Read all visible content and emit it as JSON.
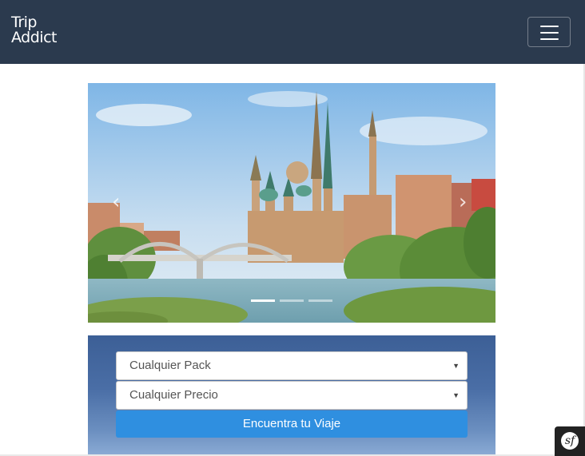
{
  "brand": {
    "line1": "Trip",
    "line2": "Addict"
  },
  "navbar": {
    "toggler_icon": "hamburger-icon"
  },
  "carousel": {
    "prev_icon": "‹",
    "next_icon": "›",
    "indicators": 3,
    "active_slide": 1
  },
  "search": {
    "pack_select": "Cualquier Pack",
    "price_select": "Cualquier Precio",
    "submit_label": "Encuentra tu Viaje"
  },
  "toolbar": {
    "symfony_label": "sf"
  },
  "colors": {
    "navbar": "#2b3a4e",
    "button": "#2f8fe0",
    "panel": "#3c5f96"
  }
}
